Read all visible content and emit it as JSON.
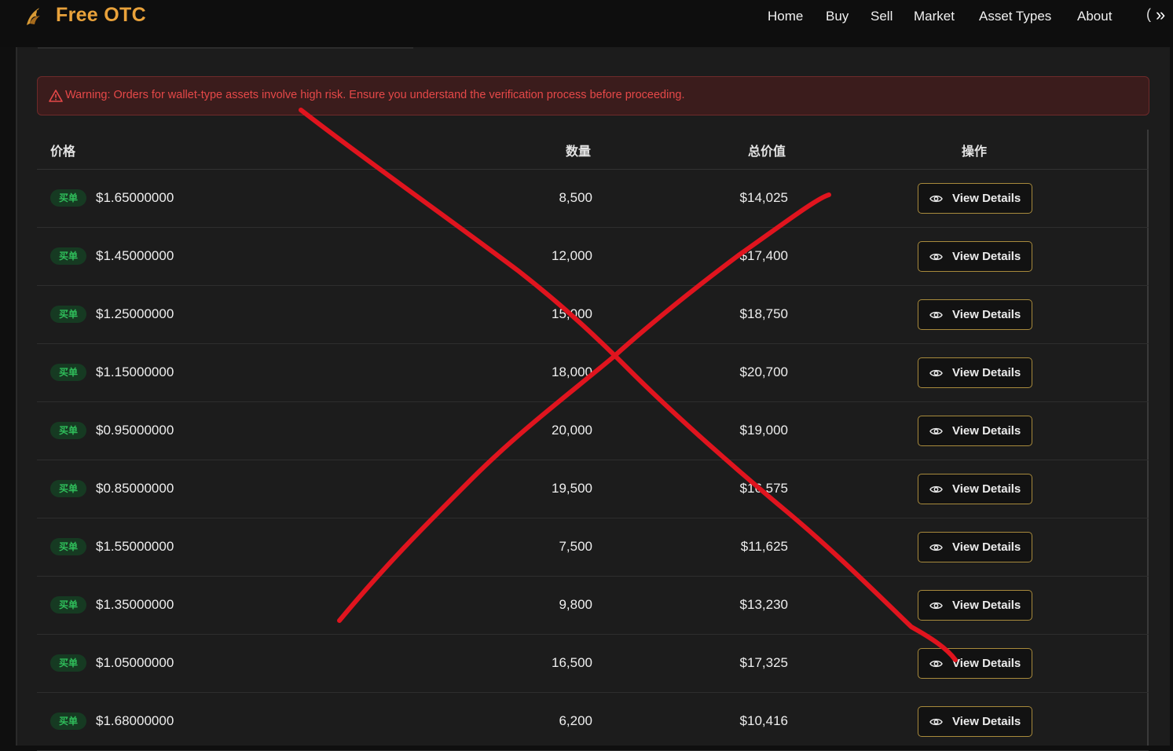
{
  "app": {
    "brand": "Free OTC"
  },
  "nav": {
    "items": [
      "Home",
      "Buy",
      "Sell",
      "Market",
      "Asset Types",
      "About"
    ]
  },
  "warning": {
    "text": "Warning: Orders for wallet-type assets involve high risk. Ensure you understand the verification process before proceeding."
  },
  "table": {
    "headers": {
      "price": "价格",
      "quantity": "数量",
      "total": "总价值",
      "action": "操作"
    },
    "rows": [
      {
        "badge": "买单",
        "price": "$1.65000000",
        "quantity": "8,500",
        "total": "$14,025",
        "action": "View Details"
      },
      {
        "badge": "买单",
        "price": "$1.45000000",
        "quantity": "12,000",
        "total": "$17,400",
        "action": "View Details"
      },
      {
        "badge": "买单",
        "price": "$1.25000000",
        "quantity": "15,000",
        "total": "$18,750",
        "action": "View Details"
      },
      {
        "badge": "买单",
        "price": "$1.15000000",
        "quantity": "18,000",
        "total": "$20,700",
        "action": "View Details"
      },
      {
        "badge": "买单",
        "price": "$0.95000000",
        "quantity": "20,000",
        "total": "$19,000",
        "action": "View Details"
      },
      {
        "badge": "买单",
        "price": "$0.85000000",
        "quantity": "19,500",
        "total": "$16,575",
        "action": "View Details"
      },
      {
        "badge": "买单",
        "price": "$1.55000000",
        "quantity": "7,500",
        "total": "$11,625",
        "action": "View Details"
      },
      {
        "badge": "买单",
        "price": "$1.35000000",
        "quantity": "9,800",
        "total": "$13,230",
        "action": "View Details"
      },
      {
        "badge": "买单",
        "price": "$1.05000000",
        "quantity": "16,500",
        "total": "$17,325",
        "action": "View Details"
      },
      {
        "badge": "买单",
        "price": "$1.68000000",
        "quantity": "6,200",
        "total": "$10,416",
        "action": "View Details"
      }
    ]
  },
  "colors": {
    "accent": "#e9a23b",
    "danger": "#e54848",
    "badge_green": "#2fbd5a",
    "annotation_red": "#e0141e"
  }
}
